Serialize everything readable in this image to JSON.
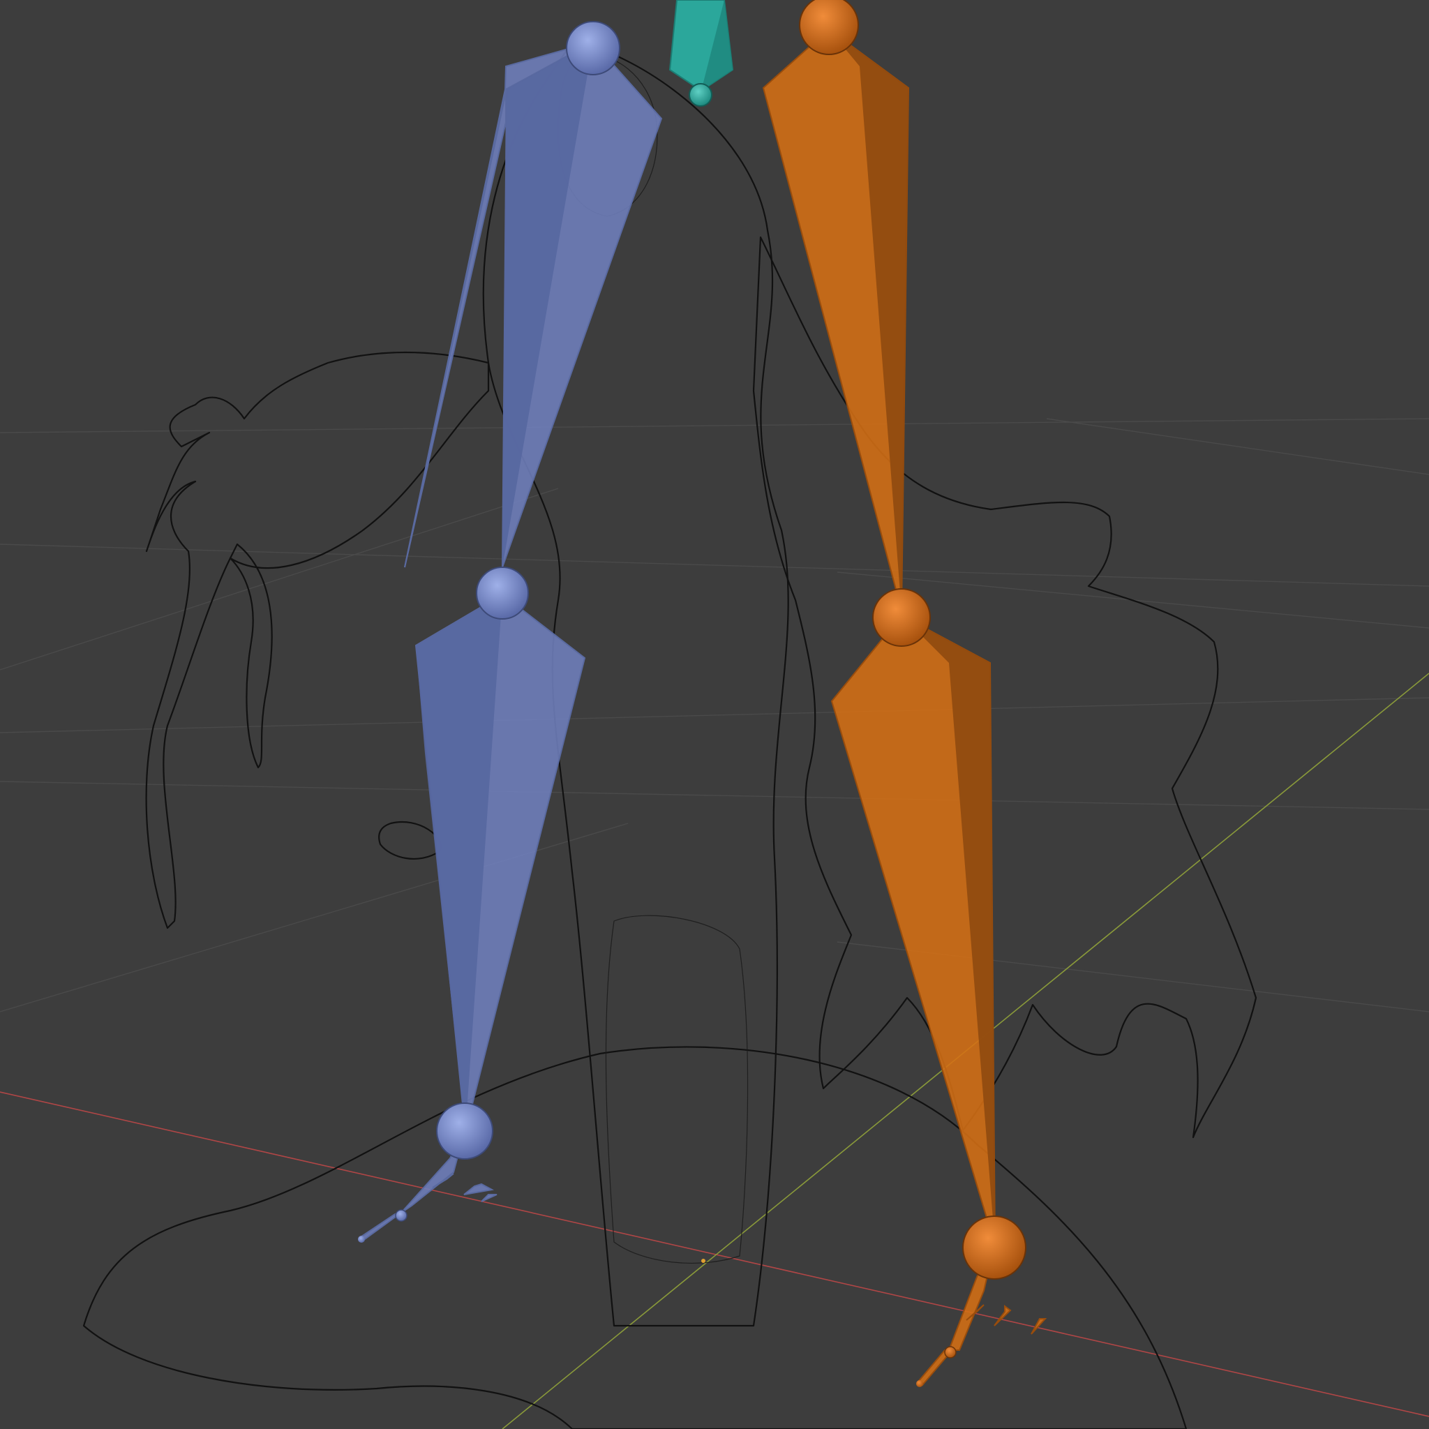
{
  "viewport": {
    "mode": "wireframe-armature-view",
    "background_color": "#3d3d3d",
    "grid_color": "#4a4a4a",
    "x_axis_color": "#b04646",
    "y_axis_color": "#8a9a3a",
    "mesh_color": "#111111"
  },
  "armature": {
    "left_chain_color": "#6f80bd",
    "right_chain_color": "#d56f14",
    "center_bone_color": "#2ba79b",
    "bones": [
      {
        "name": "thigh-left",
        "side": "left"
      },
      {
        "name": "shin-left",
        "side": "left"
      },
      {
        "name": "foot-left",
        "side": "left"
      },
      {
        "name": "thigh-right",
        "side": "right"
      },
      {
        "name": "shin-right",
        "side": "right"
      },
      {
        "name": "foot-right",
        "side": "right"
      },
      {
        "name": "spine-root",
        "side": "center"
      }
    ]
  }
}
